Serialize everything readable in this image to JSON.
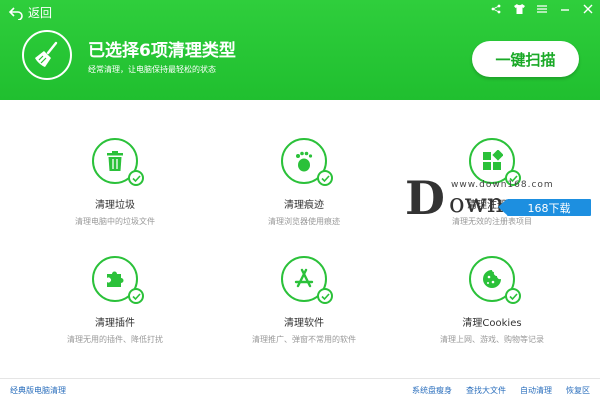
{
  "header": {
    "back_label": "返回",
    "title": "已选择6项清理类型",
    "subtitle": "经常清理，让电脑保持最轻松的状态",
    "scan_button": "一键扫描"
  },
  "cards": [
    {
      "name": "清理垃圾",
      "desc": "清理电脑中的垃圾文件",
      "icon": "trash-icon"
    },
    {
      "name": "清理痕迹",
      "desc": "清理浏览器使用痕迹",
      "icon": "footprint-icon"
    },
    {
      "name": "清理注册表",
      "desc": "清理无效的注册表项目",
      "icon": "registry-icon"
    },
    {
      "name": "清理插件",
      "desc": "清理无用的插件、降低打扰",
      "icon": "puzzle-icon"
    },
    {
      "name": "清理软件",
      "desc": "清理推广、弹窗不常用的软件",
      "icon": "app-icon"
    },
    {
      "name": "清理Cookies",
      "desc": "清理上网、游戏、购物等记录",
      "icon": "cookie-icon"
    }
  ],
  "watermark": {
    "letter": "D",
    "word": "own",
    "url": "www.down168.com",
    "badge": "168下载"
  },
  "footer": {
    "left": "经典版电脑清理",
    "right": [
      "系统盘瘦身",
      "查找大文件",
      "自动清理",
      "恢复区"
    ]
  },
  "colors": {
    "brand_green": "#22c232",
    "link_blue": "#2b6fbd",
    "badge_blue": "#1d8fe0"
  }
}
